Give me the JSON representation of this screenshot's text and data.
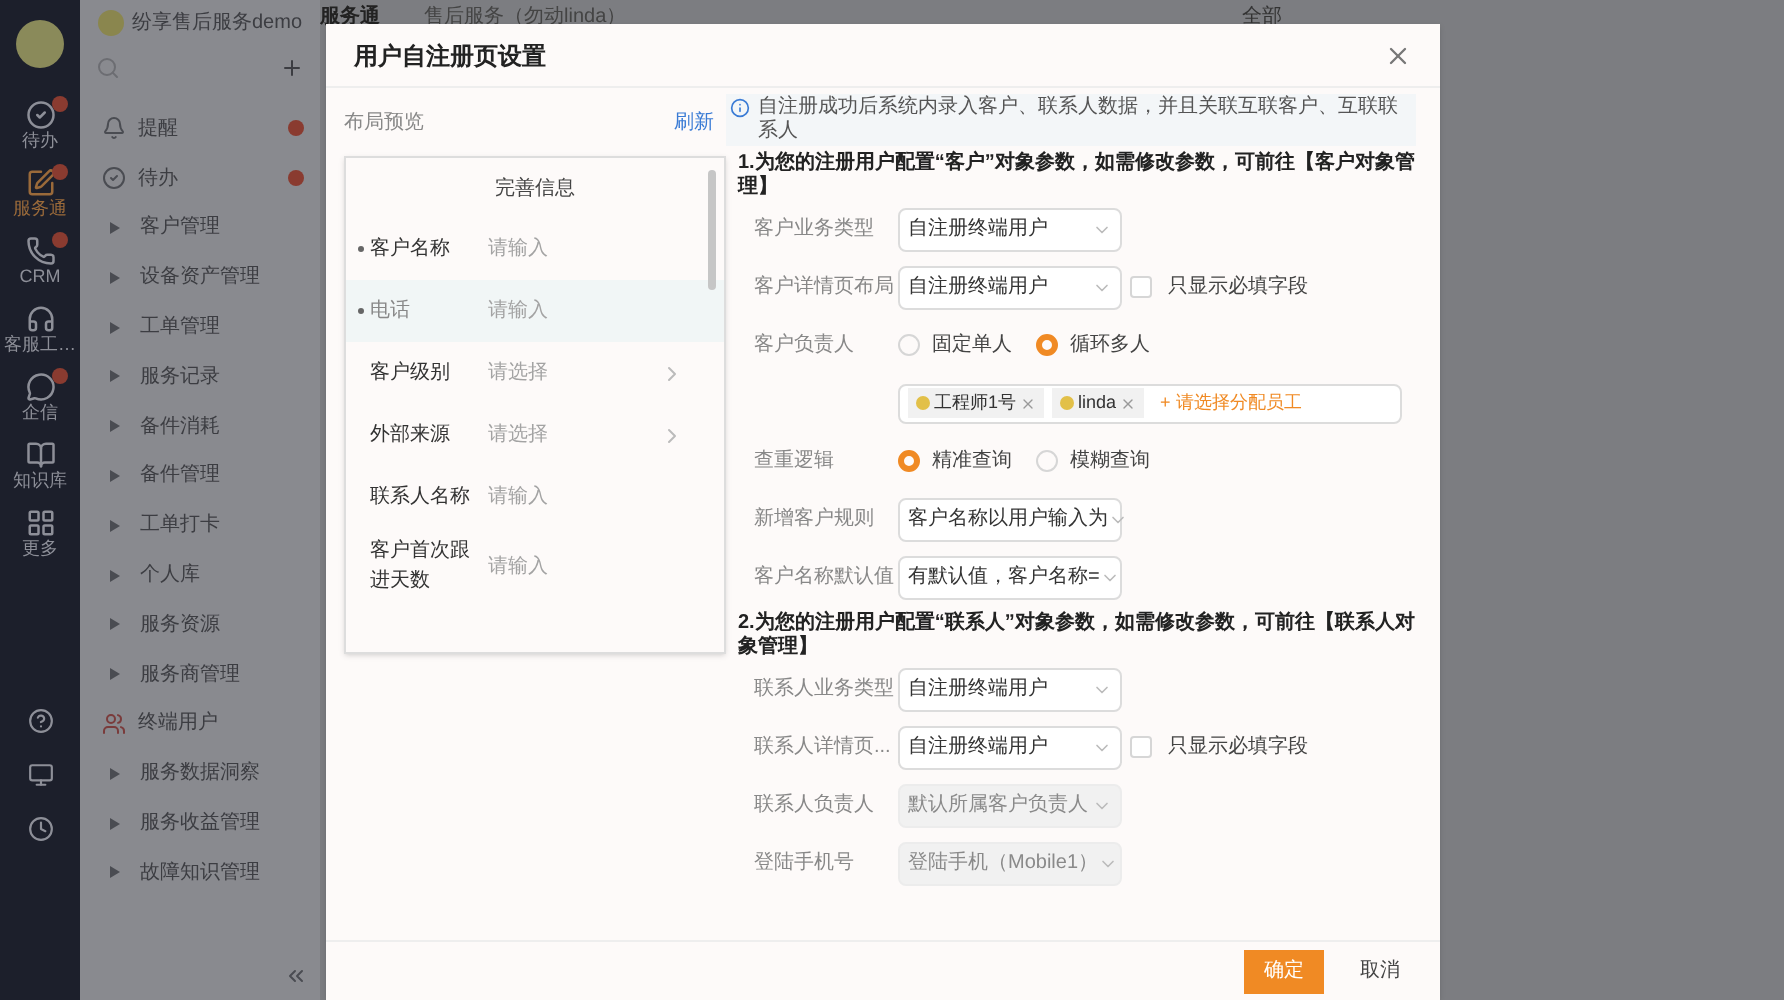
{
  "top_bar": {
    "company": "纷享售后服务demo",
    "app": "服务通",
    "workspace": "售后服务（勿动linda）",
    "filter": "全部"
  },
  "rail": {
    "items": [
      {
        "label": "待办",
        "badge": true,
        "selected": false
      },
      {
        "label": "服务通",
        "badge": true,
        "selected": true
      },
      {
        "label": "CRM",
        "badge": true,
        "selected": false
      },
      {
        "label": "客服工…",
        "badge": false,
        "selected": false
      },
      {
        "label": "企信",
        "badge": true,
        "selected": false
      },
      {
        "label": "知识库",
        "badge": false,
        "selected": false
      },
      {
        "label": "更多",
        "badge": false,
        "selected": false
      }
    ]
  },
  "menu": {
    "items": [
      {
        "label": "提醒",
        "kind": "bell",
        "badge": true
      },
      {
        "label": "待办",
        "kind": "todo",
        "badge": true
      },
      {
        "label": "客户管理",
        "kind": "group",
        "badge": false
      },
      {
        "label": "设备资产管理",
        "kind": "group",
        "badge": false
      },
      {
        "label": "工单管理",
        "kind": "group",
        "badge": false
      },
      {
        "label": "服务记录",
        "kind": "group",
        "badge": false
      },
      {
        "label": "备件消耗",
        "kind": "group",
        "badge": false
      },
      {
        "label": "备件管理",
        "kind": "group",
        "badge": false
      },
      {
        "label": "工单打卡",
        "kind": "group",
        "badge": false
      },
      {
        "label": "个人库",
        "kind": "group",
        "badge": false
      },
      {
        "label": "服务资源",
        "kind": "group",
        "badge": false
      },
      {
        "label": "服务商管理",
        "kind": "group",
        "badge": false
      },
      {
        "label": "终端用户",
        "kind": "users",
        "badge": false
      },
      {
        "label": "服务数据洞察",
        "kind": "group",
        "badge": false
      },
      {
        "label": "服务收益管理",
        "kind": "group",
        "badge": false
      },
      {
        "label": "故障知识管理",
        "kind": "group",
        "badge": false
      }
    ]
  },
  "modal": {
    "title": "用户自注册页设置",
    "preview": {
      "title": "布局预览",
      "refresh": "刷新",
      "heading": "完善信息",
      "fields": [
        {
          "label": "客户名称",
          "placeholder": "请输入",
          "kind": "input",
          "required": true,
          "selected": false
        },
        {
          "label": "电话",
          "placeholder": "请输入",
          "kind": "input",
          "required": true,
          "selected": true
        },
        {
          "label": "客户级别",
          "placeholder": "请选择",
          "kind": "select",
          "required": false,
          "selected": false
        },
        {
          "label": "外部来源",
          "placeholder": "请选择",
          "kind": "select",
          "required": false,
          "selected": false
        },
        {
          "label": "联系人名称",
          "placeholder": "请输入",
          "kind": "input",
          "required": false,
          "selected": false
        },
        {
          "label": "客户首次跟进天数",
          "placeholder": "请输入",
          "kind": "input",
          "required": false,
          "selected": false
        }
      ]
    },
    "info": "自注册成功后系统内录入客户、联系人数据，并且关联互联客户、互联联系人",
    "sections": [
      {
        "heading": "1.为您的注册用户配置“客户”对象参数，如需修改参数，可前往【客户对象管理】",
        "rows": [
          {
            "kind": "select",
            "label": "客户业务类型",
            "value": "自注册终端用户",
            "disabled": false
          },
          {
            "kind": "select_check",
            "label": "客户详情页布局",
            "value": "自注册终端用户",
            "checkbox_label": "只显示必填字段",
            "checked": false
          },
          {
            "kind": "radio",
            "label": "客户负责人",
            "options": [
              {
                "label": "固定单人",
                "selected": false
              },
              {
                "label": "循环多人",
                "selected": true
              }
            ]
          },
          {
            "kind": "tags",
            "tags": [
              {
                "label": "工程师1号"
              },
              {
                "label": "linda"
              }
            ],
            "hint": "+ 请选择分配员工"
          },
          {
            "kind": "radio",
            "label": "查重逻辑",
            "options": [
              {
                "label": "精准查询",
                "selected": true
              },
              {
                "label": "模糊查询",
                "selected": false
              }
            ]
          },
          {
            "kind": "select",
            "label": "新增客户规则",
            "value": "客户名称以用户输入为",
            "disabled": false
          },
          {
            "kind": "select",
            "label": "客户名称默认值",
            "value": "有默认值，客户名称=",
            "disabled": false
          }
        ]
      },
      {
        "heading": "2.为您的注册用户配置“联系人”对象参数，如需修改参数，可前往【联系人对象管理】",
        "rows": [
          {
            "kind": "select",
            "label": "联系人业务类型",
            "value": "自注册终端用户",
            "disabled": false
          },
          {
            "kind": "select_check",
            "label": "联系人详情页...",
            "value": "自注册终端用户",
            "checkbox_label": "只显示必填字段",
            "checked": false
          },
          {
            "kind": "select",
            "label": "联系人负责人",
            "value": "默认所属客户负责人",
            "disabled": true
          },
          {
            "kind": "select",
            "label": "登陆手机号",
            "value": "登陆手机（Mobile1）",
            "disabled": true
          }
        ]
      }
    ],
    "confirm": "确定",
    "cancel": "取消"
  }
}
